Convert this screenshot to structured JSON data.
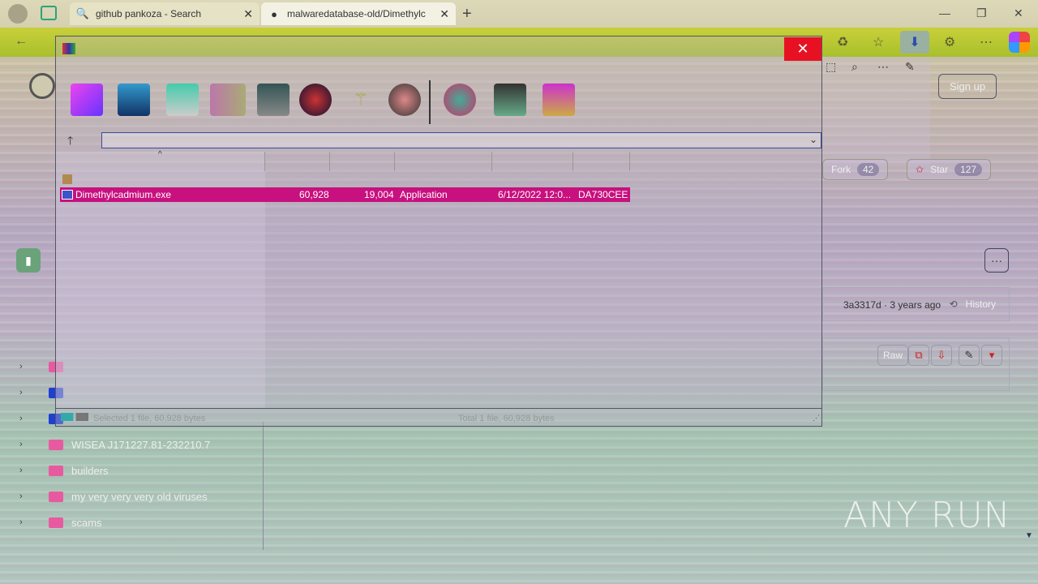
{
  "browser": {
    "tabs": [
      {
        "title": "github pankoza - Search",
        "icon": "search-icon"
      },
      {
        "title": "malwaredatabase-old/Dimethylc",
        "icon": "github-icon"
      }
    ],
    "window_controls": {
      "minimize": "—",
      "restore": "❐",
      "close": "✕"
    },
    "new_tab": "+"
  },
  "github": {
    "signup": "Sign up",
    "fork_label": "Fork",
    "fork_count": "42",
    "star_label": "Star",
    "star_count": "127",
    "commit_text": "3a3317d · 3 years ago",
    "history_label": "History",
    "raw_label": "Raw",
    "tree": [
      {
        "name": "",
        "color": "pink"
      },
      {
        "name": "",
        "color": "blue"
      },
      {
        "name": "",
        "color": "blue"
      },
      {
        "name": "WISEA J171227.81-232210.7",
        "color": "pink"
      },
      {
        "name": "builders",
        "color": "pink"
      },
      {
        "name": "my very very very old viruses",
        "color": "pink"
      },
      {
        "name": "scams",
        "color": "pink"
      }
    ]
  },
  "file_manager": {
    "close_symbol": "✕",
    "toolbar": [
      "extract-icon",
      "open-folder-icon",
      "edit-icon",
      "book-icon",
      "delete-icon",
      "find-icon",
      "wizard-icon",
      "info-icon",
      "virus-scan-icon",
      "comment-icon",
      "sfx-icon"
    ],
    "path_value": "",
    "file": {
      "name": "Dimethylcadmium.exe",
      "size": "60,928",
      "packed": "19,004",
      "type": "Application",
      "modified": "6/12/2022 12:0...",
      "crc": "DA730CEE"
    },
    "status_left": "Selected 1 file, 60,928 bytes",
    "status_right": "Total 1 file, 60,928 bytes"
  },
  "watermark": "ANY RUN"
}
